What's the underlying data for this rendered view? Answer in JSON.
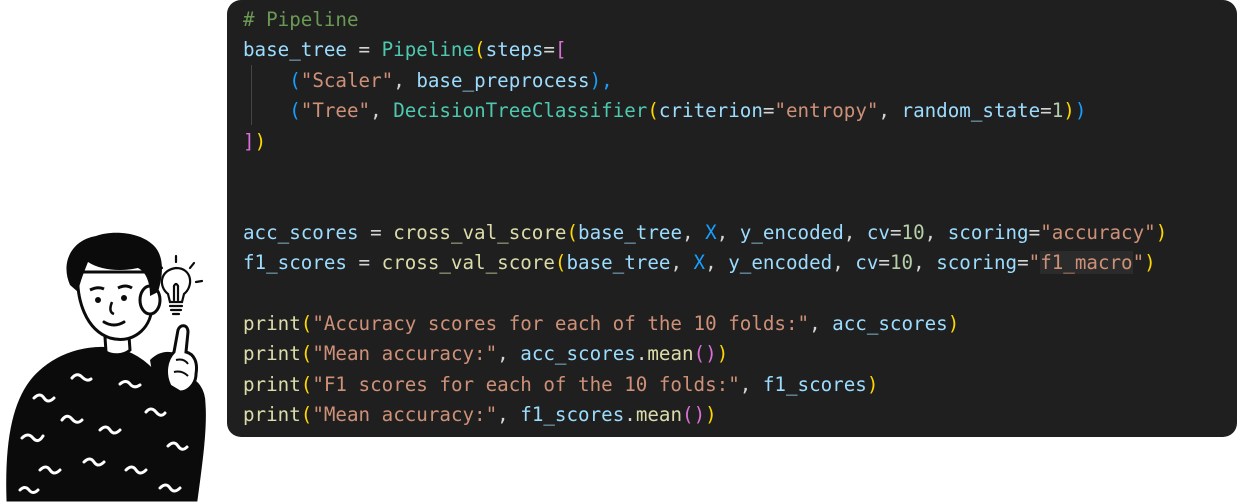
{
  "code": {
    "comment": "# Pipeline",
    "line2": {
      "var": "base_tree",
      "op": " = ",
      "cls": "Pipeline",
      "paren": "(",
      "kw": "steps",
      "eq": "=",
      "bracket": "["
    },
    "line3": {
      "open": "(",
      "str": "\"Scaler\"",
      "comma": ", ",
      "var": "base_preprocess",
      "close": "),"
    },
    "line4": {
      "open": "(",
      "str": "\"Tree\"",
      "comma": ", ",
      "cls": "DecisionTreeClassifier",
      "p_open": "(",
      "kw1": "criterion",
      "eq1": "=",
      "str2": "\"entropy\"",
      "comma2": ", ",
      "kw2": "random_state",
      "eq2": "=",
      "num": "1",
      "p_close": ")",
      "close": ")"
    },
    "line5": {
      "bracket": "]",
      "paren": ")"
    },
    "line8": {
      "var": "acc_scores",
      "op": " = ",
      "fn": "cross_val_score",
      "open": "(",
      "a1": "base_tree",
      "c1": ", ",
      "a2": "X",
      "c2": ", ",
      "a3": "y_encoded",
      "c3": ", ",
      "kw1": "cv",
      "eq1": "=",
      "num": "10",
      "c4": ", ",
      "kw2": "scoring",
      "eq2": "=",
      "str": "\"accuracy\"",
      "close": ")"
    },
    "line9": {
      "var": "f1_scores",
      "op": " = ",
      "fn": "cross_val_score",
      "open": "(",
      "a1": "base_tree",
      "c1": ", ",
      "a2": "X",
      "c2": ", ",
      "a3": "y_encoded",
      "c3": ", ",
      "kw1": "cv",
      "eq1": "=",
      "num": "10",
      "c4": ", ",
      "kw2": "scoring",
      "eq2": "=",
      "str_q1": "\"",
      "str_hl": "f1_macro",
      "str_q2": "\"",
      "close": ")"
    },
    "line11": {
      "fn": "print",
      "open": "(",
      "str": "\"Accuracy scores for each of the 10 folds:\"",
      "comma": ", ",
      "var": "acc_scores",
      "close": ")"
    },
    "line12": {
      "fn": "print",
      "open": "(",
      "str": "\"Mean accuracy:\"",
      "comma": ", ",
      "var": "acc_scores",
      "dot": ".",
      "method": "mean",
      "call": "()",
      "close": ")"
    },
    "line13": {
      "fn": "print",
      "open": "(",
      "str": "\"F1 scores for each of the 10 folds:\"",
      "comma": ", ",
      "var": "f1_scores",
      "close": ")"
    },
    "line14": {
      "fn": "print",
      "open": "(",
      "str": "\"Mean accuracy:\"",
      "comma": ", ",
      "var": "f1_scores",
      "dot": ".",
      "method": "mean",
      "call": "()",
      "close": ")"
    }
  }
}
